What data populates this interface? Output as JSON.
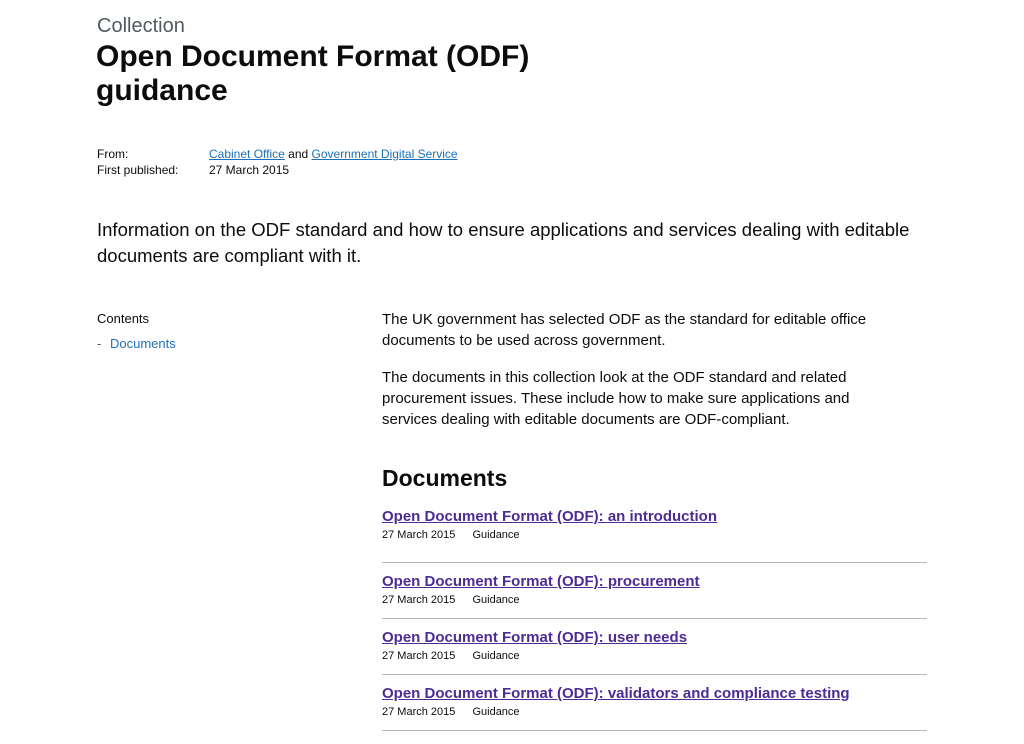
{
  "header": {
    "label": "Collection",
    "title": "Open Document Format (ODF) guidance"
  },
  "metadata": {
    "from_label": "From:",
    "from_org1": "Cabinet Office",
    "from_and": "and",
    "from_org2": "Government Digital Service",
    "published_label": "First published:",
    "published_date": "27 March 2015"
  },
  "summary": "Information on the ODF standard and how to ensure applications and services dealing with editable documents are compliant with it.",
  "contents": {
    "heading": "Contents",
    "items": [
      {
        "dash": "-",
        "label": "Documents"
      }
    ]
  },
  "body": {
    "paragraphs": [
      "The UK government has selected ODF as the standard for editable office documents to be used across government.",
      "The documents in this collection look at the ODF standard and related procurement issues. These include how to make sure applications and services dealing with editable documents are ODF-compliant."
    ]
  },
  "documents": {
    "heading": "Documents",
    "items": [
      {
        "title": "Open Document Format (ODF): an introduction",
        "date": "27 March 2015",
        "type": "Guidance"
      },
      {
        "title": "Open Document Format (ODF): procurement",
        "date": "27 March 2015",
        "type": "Guidance"
      },
      {
        "title": "Open Document Format (ODF): user needs",
        "date": "27 March 2015",
        "type": "Guidance"
      },
      {
        "title": "Open Document Format (ODF): validators and compliance testing",
        "date": "27 March 2015",
        "type": "Guidance"
      }
    ]
  },
  "colors": {
    "link": "#1d70b8",
    "visited_link": "#4c2c92",
    "text": "#0b0c0c",
    "secondary_text": "#505a5f",
    "divider": "#b1b4b6"
  }
}
